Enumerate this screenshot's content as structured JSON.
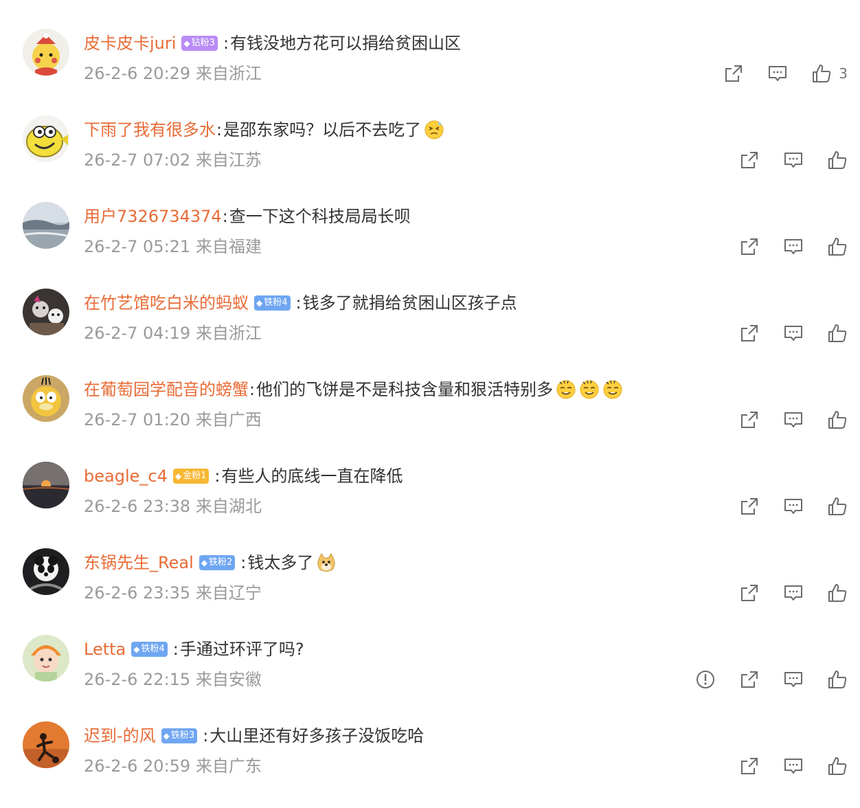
{
  "comments": [
    {
      "user": "皮卡皮卡juri",
      "badge": {
        "label": "钻粉3",
        "kind": "diamond"
      },
      "text": "有钱没地方花可以捐给贫困山区",
      "time": "26-2-6 20:29",
      "location": "来自浙江",
      "likes": "3",
      "emojis": []
    },
    {
      "user": "下雨了我有很多水",
      "badge": null,
      "text": "是邵东家吗？以后不去吃了",
      "time": "26-2-7 07:02",
      "location": "来自江苏",
      "likes": "",
      "emojis": [
        "dizzy-face-emoji"
      ]
    },
    {
      "user": "用户7326734374",
      "badge": null,
      "text": "查一下这个科技局局长呗",
      "time": "26-2-7 05:21",
      "location": "来自福建",
      "likes": "",
      "emojis": []
    },
    {
      "user": "在竹艺馆吃白米的蚂蚁",
      "badge": {
        "label": "铁粉4",
        "kind": "iron"
      },
      "text": "钱多了就捐给贫困山区孩子点",
      "time": "26-2-7 04:19",
      "location": "来自浙江",
      "likes": "",
      "emojis": []
    },
    {
      "user": "在葡萄园学配音的螃蟹",
      "badge": null,
      "text": "他们的飞饼是不是科技含量和狠活特别多",
      "time": "26-2-7 01:20",
      "location": "来自广西",
      "likes": "",
      "emojis": [
        "sweat-smile-emoji",
        "sweat-smile-emoji",
        "sweat-smile-emoji"
      ]
    },
    {
      "user": "beagle_c4",
      "badge": {
        "label": "金粉1",
        "kind": "gold"
      },
      "text": "有些人的底线一直在降低",
      "time": "26-2-6 23:38",
      "location": "来自湖北",
      "likes": "",
      "emojis": []
    },
    {
      "user": "东锅先生_Real",
      "badge": {
        "label": "铁粉2",
        "kind": "iron"
      },
      "text": "钱太多了",
      "time": "26-2-6 23:35",
      "location": "来自辽宁",
      "likes": "",
      "emojis": [
        "doge-emoji"
      ]
    },
    {
      "user": "Letta",
      "badge": {
        "label": "铁粉4",
        "kind": "iron"
      },
      "text": "手通过环评了吗?",
      "time": "26-2-6 22:15",
      "location": "来自安徽",
      "likes": "",
      "emojis": [],
      "report": true
    },
    {
      "user": "迟到-的风",
      "badge": {
        "label": "铁粉3",
        "kind": "iron"
      },
      "text": "大山里还有好多孩子没饭吃哈",
      "time": "26-2-6 20:59",
      "location": "来自广东",
      "likes": "",
      "emojis": []
    }
  ],
  "colors": {
    "username": "#e86b36",
    "meta": "#9a9a9a",
    "text": "#333333",
    "icon": "#6b6b6b"
  }
}
